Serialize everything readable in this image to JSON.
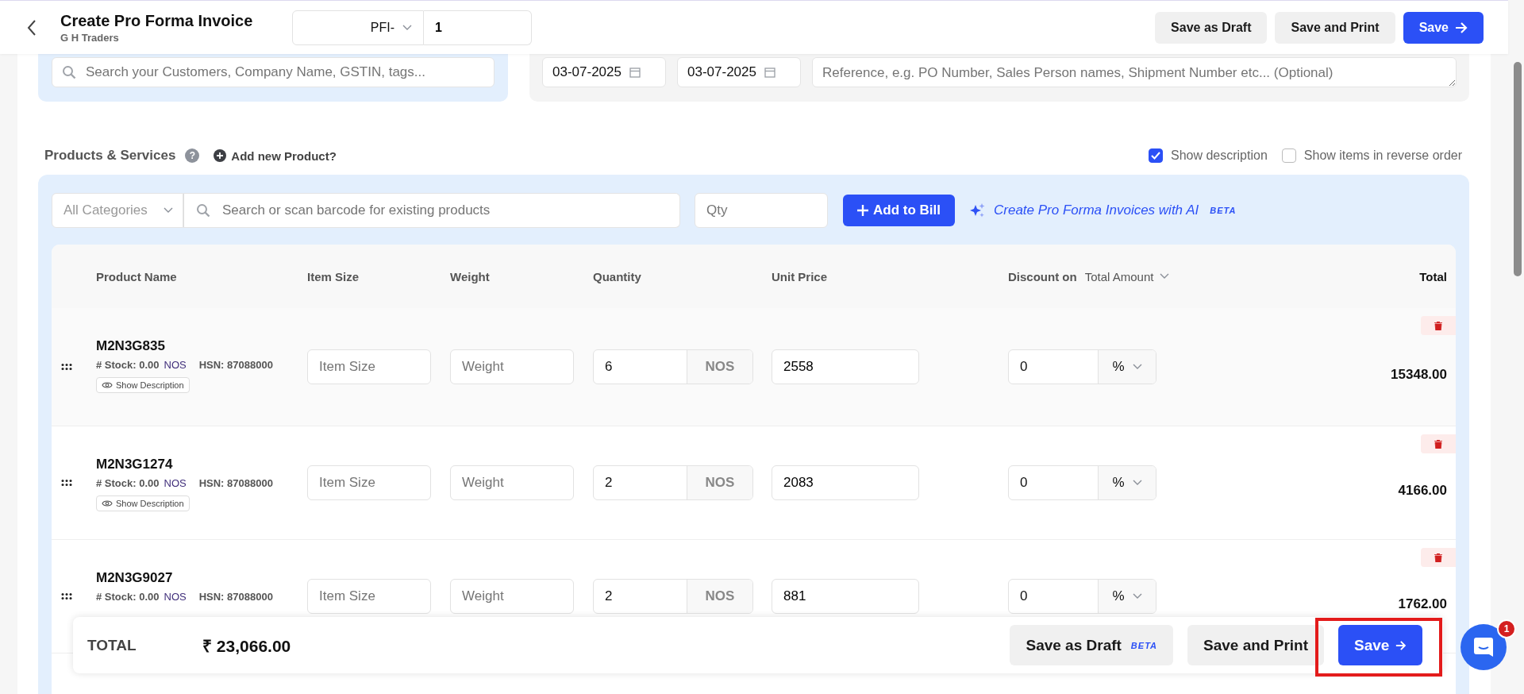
{
  "header": {
    "title": "Create Pro Forma Invoice",
    "subtitle": "G H Traders",
    "prefix": "PFI-",
    "number": "1",
    "buttons": [
      {
        "label": "Save as Draft",
        "kind": "secondary"
      },
      {
        "label": "Save and Print",
        "kind": "secondary"
      },
      {
        "label": "Save",
        "kind": "primary"
      }
    ]
  },
  "customer": {
    "placeholder": "Search your Customers, Company Name, GSTIN, tags..."
  },
  "dates": [
    "03-07-2025",
    "03-07-2025"
  ],
  "reference": {
    "placeholder": "Reference, e.g. PO Number, Sales Person names, Shipment Number etc... (Optional)"
  },
  "products": {
    "title": "Products & Services",
    "help": "?",
    "add_new": "Add new Product?",
    "options": [
      {
        "label": "Show description",
        "checked": true
      },
      {
        "label": "Show items in reverse order",
        "checked": false
      }
    ]
  },
  "toolbar": {
    "category": "All Categories",
    "search_placeholder": "Search or scan barcode for existing products",
    "qty_placeholder": "Qty",
    "add_button": "Add to Bill",
    "ai_link": "Create Pro Forma Invoices with AI",
    "ai_badge": "BETA"
  },
  "table": {
    "columns": [
      "Product Name",
      "Item Size",
      "Weight",
      "Quantity",
      "Unit Price",
      "Discount on",
      "Total"
    ],
    "discount_mode": "Total Amount",
    "rows": [
      {
        "name": "M2N3G835",
        "stock": "# Stock: 0.00",
        "stock_unit": "NOS",
        "hsn": "HSN: 87088000",
        "show_description": "Show Description",
        "item_size_placeholder": "Item Size",
        "weight_placeholder": "Weight",
        "quantity": "6",
        "unit": "NOS",
        "unit_price": "2558",
        "discount": "0",
        "discount_unit": "%",
        "total": "15348.00",
        "highlighted": true
      },
      {
        "name": "M2N3G1274",
        "stock": "# Stock: 0.00",
        "stock_unit": "NOS",
        "hsn": "HSN: 87088000",
        "show_description": "Show Description",
        "item_size_placeholder": "Item Size",
        "weight_placeholder": "Weight",
        "quantity": "2",
        "unit": "NOS",
        "unit_price": "2083",
        "discount": "0",
        "discount_unit": "%",
        "total": "4166.00",
        "highlighted": false
      },
      {
        "name": "M2N3G9027",
        "stock": "# Stock: 0.00",
        "stock_unit": "NOS",
        "hsn": "HSN: 87088000",
        "item_size_placeholder": "Item Size",
        "weight_placeholder": "Weight",
        "quantity": "2",
        "unit": "NOS",
        "unit_price": "881",
        "discount": "0",
        "discount_unit": "%",
        "total": "1762.00",
        "highlighted": false
      }
    ]
  },
  "footer": {
    "label": "TOTAL",
    "amount": "₹ 23,066.00",
    "buttons": [
      {
        "label": "Save as Draft",
        "badge": "BETA",
        "kind": "secondary"
      },
      {
        "label": "Save and Print",
        "kind": "secondary"
      },
      {
        "label": "Save",
        "kind": "primary"
      }
    ]
  },
  "chat": {
    "badge": "1"
  }
}
